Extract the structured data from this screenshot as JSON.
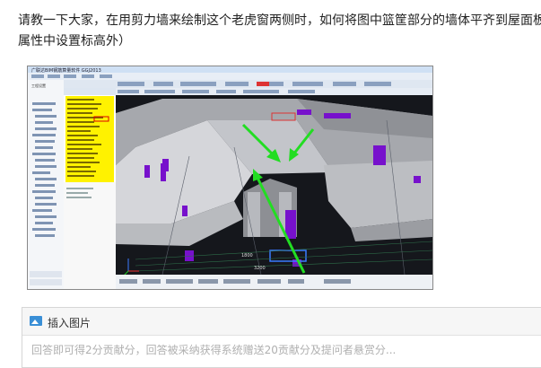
{
  "question": {
    "line1": "请教一下大家，在用剪力墙来绘制这个老虎窗两侧时，如何将图中篮筐部分的墙体平齐到屋面板",
    "line2": "属性中设置标高外）"
  },
  "screenshot": {
    "window_title": "广联达BIM钢筋算量软件 GGJ2013",
    "left_panel_title": "工程设置",
    "dims": [
      "1800",
      "3200"
    ],
    "arrow_color": "#22dd22",
    "highlight_color": "#7711cc"
  },
  "editor": {
    "insert_image_label": "插入图片",
    "answer_placeholder": "回答即可得2分贡献分，回答被采纳获得系统赠送20贡献分及提问者悬赏分..."
  }
}
